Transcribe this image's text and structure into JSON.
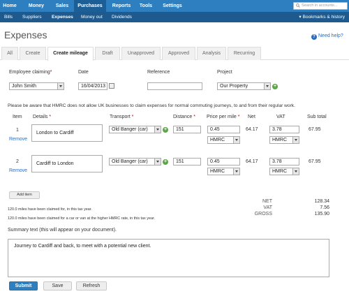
{
  "nav": {
    "items": [
      {
        "label": "Home",
        "active": false
      },
      {
        "label": "Money",
        "active": false
      },
      {
        "label": "Sales",
        "active": false
      },
      {
        "label": "Purchases",
        "active": true
      },
      {
        "label": "Reports",
        "active": false
      },
      {
        "label": "Tools",
        "active": false
      },
      {
        "label": "Settings",
        "active": false
      }
    ],
    "search_placeholder": "Search in accounts..."
  },
  "subnav": {
    "items": [
      {
        "label": "Bills",
        "active": false
      },
      {
        "label": "Suppliers",
        "active": false
      },
      {
        "label": "Expenses",
        "active": true
      },
      {
        "label": "Money out",
        "active": false
      },
      {
        "label": "Dividends",
        "active": false
      }
    ],
    "bookmarks": "Bookmarks & history"
  },
  "page": {
    "title": "Expenses",
    "help": "Need help?"
  },
  "tabs": [
    {
      "label": "All",
      "active": false
    },
    {
      "label": "Create",
      "active": false
    },
    {
      "label": "Create mileage",
      "active": true
    },
    {
      "label": "Draft",
      "active": false
    },
    {
      "label": "Unapproved",
      "active": false
    },
    {
      "label": "Approved",
      "active": false
    },
    {
      "label": "Analysis",
      "active": false
    },
    {
      "label": "Recurring",
      "active": false
    }
  ],
  "form": {
    "employee_label": "Employee claiming",
    "employee_value": "John Smith",
    "date_label": "Date",
    "date_value": "16/04/2013",
    "reference_label": "Reference",
    "reference_value": "",
    "project_label": "Project",
    "project_value": "Our Property"
  },
  "notice": "Please be aware that HMRC does not allow UK businesses to claim expenses for normal commuting journeys, to and from their regular work.",
  "table": {
    "headers": {
      "item": "Item",
      "details": "Details",
      "transport": "Transport",
      "distance": "Distance",
      "price": "Price per mile",
      "net": "Net",
      "vat": "VAT",
      "subtotal": "Sub total"
    },
    "rows": [
      {
        "item": "1",
        "remove": "Remove",
        "details": "London to Cardiff",
        "transport": "Old Banger (car)",
        "distance": "151",
        "price": "0.45",
        "rate": "HMRC",
        "net": "64.17",
        "vat": "3.78",
        "vat_rate": "HMRC",
        "subtotal": "67.95"
      },
      {
        "item": "2",
        "remove": "Remove",
        "details": "Cardiff to London",
        "transport": "Old Banger (car)",
        "distance": "151",
        "price": "0.45",
        "rate": "HMRC",
        "net": "64.17",
        "vat": "3.78",
        "vat_rate": "HMRC",
        "subtotal": "67.95"
      }
    ],
    "add_item": "Add item"
  },
  "claims": {
    "line1": "120.0 miles have been claimed for, in this tax year.",
    "line2": "120.0 miles have been claimed for a car or van at the higher HMRC rate, in this tax year."
  },
  "totals": {
    "net_label": "NET",
    "net_value": "128.34",
    "vat_label": "VAT",
    "vat_value": "7.56",
    "gross_label": "GROSS",
    "gross_value": "135.90"
  },
  "summary": {
    "label": "Summary text (this will appear on your document).",
    "value": "Journey to Cardiff and back, to meet with a potential new client."
  },
  "buttons": {
    "submit": "Submit",
    "save": "Save",
    "refresh": "Refresh"
  },
  "colors": {
    "nav": "#2e7fbf",
    "subnav": "#1e5a8d",
    "link": "#2a6ebb",
    "add": "#5aa843"
  }
}
